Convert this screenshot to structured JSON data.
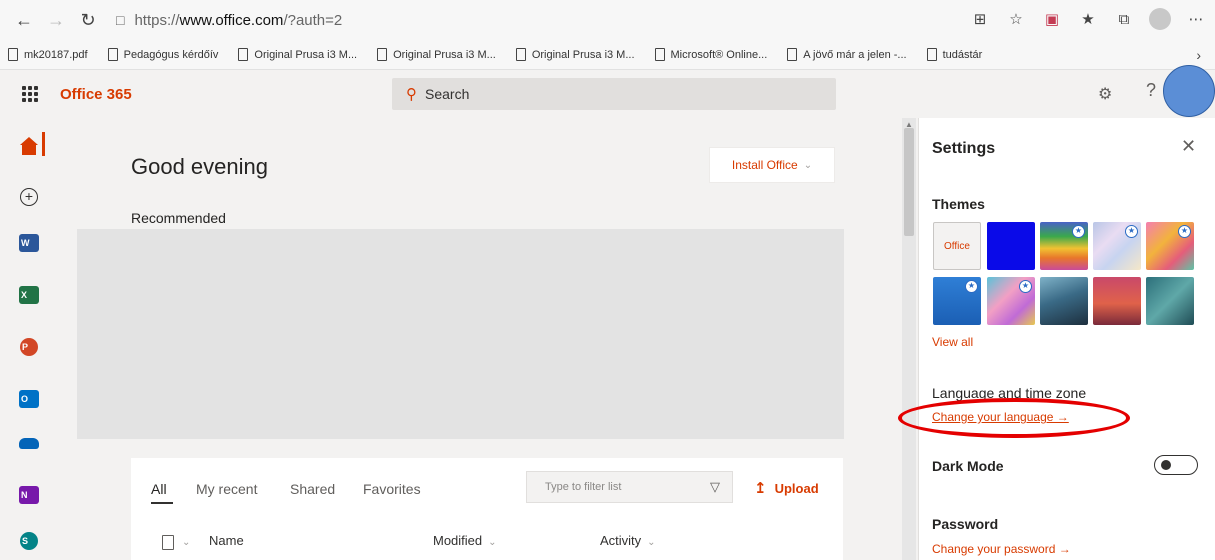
{
  "browser": {
    "url_proto": "https://",
    "url_host": "www.office.com",
    "url_path": "/?auth=2",
    "bookmarks": [
      "mk20187.pdf",
      "Pedagógus kérdőív",
      "Original Prusa i3 M...",
      "Original Prusa i3 M...",
      "Original Prusa i3 M...",
      "Microsoft® Online...",
      "A jövő már a jelen -...",
      "tudástár"
    ]
  },
  "header": {
    "brand": "Office 365",
    "search_placeholder": "Search"
  },
  "main": {
    "greeting": "Good evening",
    "install_label": "Install Office",
    "recommended_label": "Recommended"
  },
  "files": {
    "tabs": [
      "All",
      "My recent",
      "Shared",
      "Favorites"
    ],
    "filter_placeholder": "Type to filter list",
    "upload_label": "Upload",
    "columns": [
      "Name",
      "Modified",
      "Activity"
    ]
  },
  "settings": {
    "title": "Settings",
    "themes_label": "Themes",
    "office_theme_label": "Office",
    "view_all": "View all",
    "language_heading": "Language and time zone",
    "change_language": "Change your language →",
    "dark_mode": "Dark Mode",
    "password_heading": "Password",
    "change_password": "Change your password →"
  },
  "colors": {
    "accent": "#d83b01",
    "annotation_circle": "#5b8ed6",
    "annotation_ellipse": "#e40000"
  }
}
